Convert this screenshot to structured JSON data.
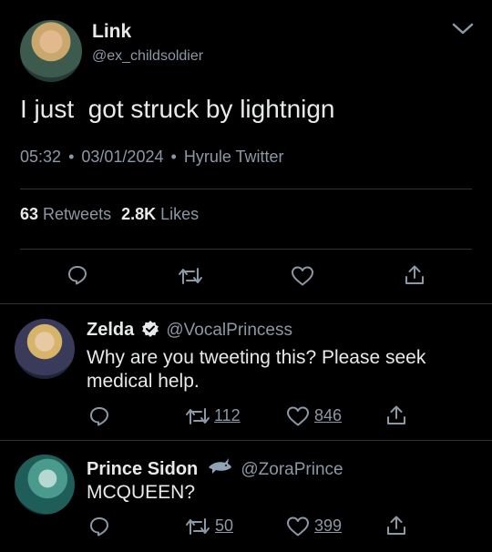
{
  "tweet": {
    "display_name": "Link",
    "handle": "@ex_childsoldier",
    "text": "I just  got struck by lightnign",
    "time": "05:32",
    "date": "03/01/2024",
    "client": "Hyrule Twitter",
    "retweets_count": "63",
    "retweets_label": "Retweets",
    "likes_count": "2.8K",
    "likes_label": "Likes",
    "sep": "•"
  },
  "replies": [
    {
      "display_name": "Zelda",
      "handle": "@VocalPrincess",
      "text": "Why are you tweeting this? Please seek medical help.",
      "retweets": "112",
      "likes": "846"
    },
    {
      "display_name": "Prince Sidon",
      "handle": "@ZoraPrince",
      "text": "MCQUEEN?",
      "retweets": "50",
      "likes": "399"
    }
  ],
  "icons": {
    "more": "chevron-down-icon",
    "reply": "reply-icon",
    "retweet": "retweet-icon",
    "like": "heart-icon",
    "share": "share-icon",
    "verified": "verified-badge-icon",
    "emoji": "shark-emoji-icon"
  },
  "colors": {
    "background": "#000000",
    "text": "#e7e9ea",
    "secondary": "#8b98a5",
    "divider": "#2f3336"
  }
}
